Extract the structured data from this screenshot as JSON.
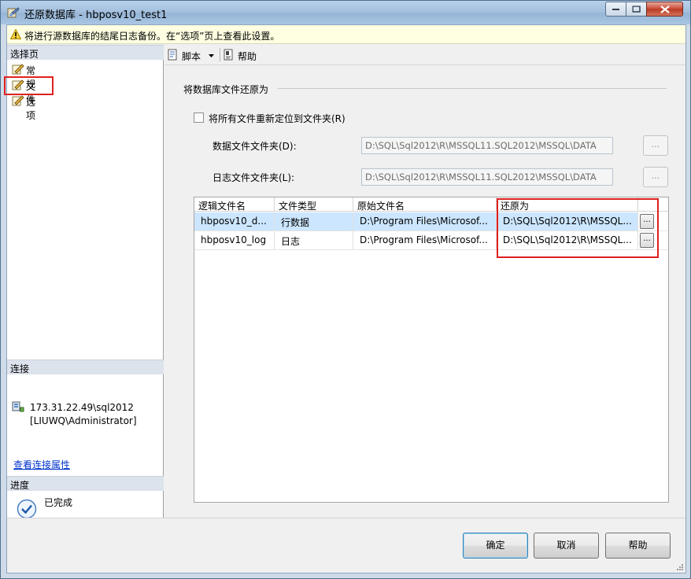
{
  "window": {
    "title": "还原数据库 - hbposv10_test1"
  },
  "warning": {
    "text": "将进行源数据库的结尾日志备份。在“选项”页上查看此设置。",
    "icon": "warning-triangle-icon"
  },
  "left_panel": {
    "pages_header": "选择页",
    "pages": [
      {
        "label": "常规",
        "icon": "page-icon"
      },
      {
        "label": "文件",
        "icon": "page-icon",
        "selected": true
      },
      {
        "label": "选项",
        "icon": "page-icon"
      }
    ],
    "connection_header": "连接",
    "connection_server": "173.31.22.49\\sql2012",
    "connection_user": "[LIUWQ\\Administrator]",
    "connection_link": "查看连接属性",
    "progress_header": "进度",
    "progress_status": "已完成"
  },
  "toolbar": {
    "script_label": "脚本",
    "help_label": "帮助"
  },
  "files": {
    "group_title": "将数据库文件还原为",
    "relocate_checkbox_label": "将所有文件重新定位到文件夹(R)",
    "relocate_checked": false,
    "data_folder_label": "数据文件文件夹(D):",
    "data_folder_value": "D:\\SQL\\Sql2012\\R\\MSSQL11.SQL2012\\MSSQL\\DATA",
    "log_folder_label": "日志文件文件夹(L):",
    "log_folder_value": "D:\\SQL\\Sql2012\\R\\MSSQL11.SQL2012\\MSSQL\\DATA",
    "browse_label": "...",
    "grid": {
      "columns": [
        "逻辑文件名",
        "文件类型",
        "原始文件名",
        "还原为"
      ],
      "rows": [
        {
          "logical": "hbposv10_d...",
          "type": "行数据",
          "original": "D:\\Program Files\\Microsof...",
          "restore_as": "D:\\SQL\\Sql2012\\R\\MSSQL...",
          "selected": true
        },
        {
          "logical": "hbposv10_log",
          "type": "日志",
          "original": "D:\\Program Files\\Microsof...",
          "restore_as": "D:\\SQL\\Sql2012\\R\\MSSQL...",
          "selected": false
        }
      ],
      "cell_button_label": "..."
    }
  },
  "buttons": {
    "ok": "确定",
    "cancel": "取消",
    "help": "帮助"
  },
  "colors": {
    "highlight_box": "#e02020",
    "selected_row": "#cce6ff",
    "link": "#0033cc"
  }
}
